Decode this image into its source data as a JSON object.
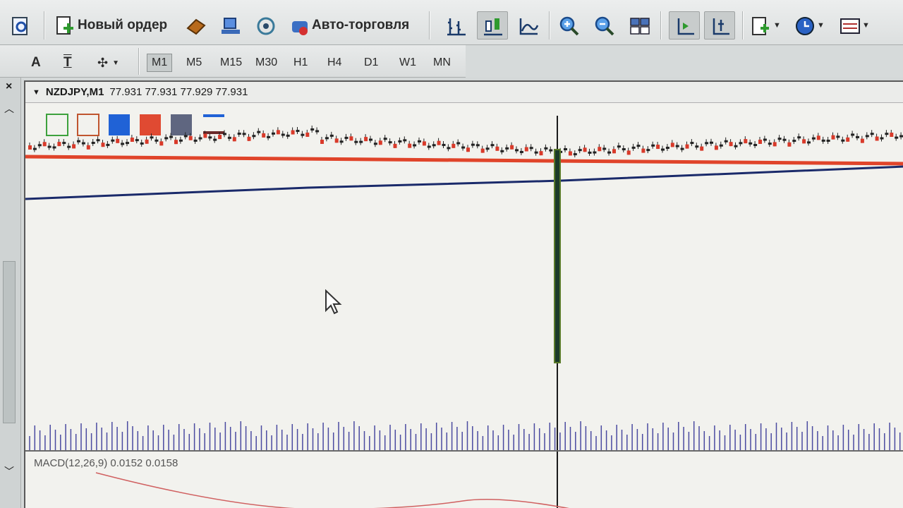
{
  "toolbar": {
    "new_order_label": "Новый ордер",
    "autotrading_label": "Авто-торговля",
    "icons": [
      "new-order-icon",
      "book-icon",
      "terminal-icon",
      "signal-icon",
      "autotrading-icon",
      "bar-chart-icon",
      "candle-chart-icon",
      "line-chart-icon",
      "zoom-in-icon",
      "zoom-out-icon",
      "tile-windows-icon",
      "autoscroll-icon",
      "chart-shift-icon",
      "indicators-icon",
      "periods-icon",
      "templates-icon"
    ]
  },
  "timeframes": {
    "items": [
      "M1",
      "M5",
      "M15",
      "M30",
      "H1",
      "H4",
      "D1",
      "W1",
      "MN"
    ],
    "active": "M1",
    "text_tool": "A",
    "text_label_tool": "T"
  },
  "chart": {
    "symbol": "NZDJPY,M1",
    "ohlc": "77.931 77.931 77.929 77.931",
    "legend_colors": [
      "#3da13d",
      "#c0552f",
      "#2062d6",
      "#e04a32",
      "#5f6680",
      "#2062d6"
    ],
    "colors": {
      "bull": "#ffffff",
      "bear": "#d93a2a",
      "ma_red": "#e0442a",
      "ma_blue": "#1a2a6a",
      "volume": "#4a4aa0",
      "spike": "#1b3a2a"
    }
  },
  "macd": {
    "label": "MACD(12,26,9) 0.0152 0.0158"
  }
}
